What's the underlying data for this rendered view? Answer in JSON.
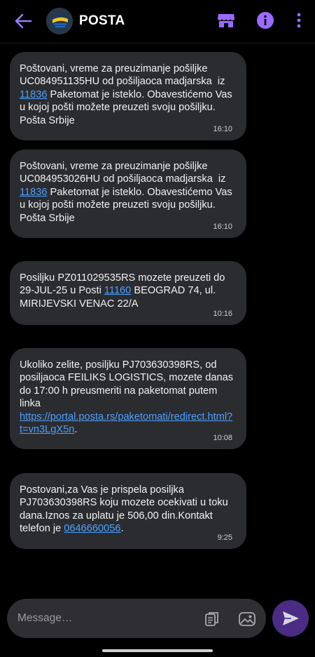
{
  "header": {
    "title": "POSTA",
    "back_icon": "arrow-back-icon",
    "avatar": "posta-logo",
    "actions": [
      "store-icon",
      "info-icon",
      "more-vert-icon"
    ],
    "accent_color": "#9b6bff"
  },
  "messages": [
    {
      "parts": [
        {
          "text": "Poštovani, vreme za preuzimanje pošiljke UC084951135HU od pošiljaoca madjarska  iz "
        },
        {
          "link": "11836"
        },
        {
          "text": " Paketomat je isteklо. Obavestićemo Vas u kojoj pošti možete preuzeti svoju pošiljku. Pošta Srbije"
        }
      ],
      "time": "16:10"
    },
    {
      "parts": [
        {
          "text": "Poštovani, vreme za preuzimanje pošiljke UC084953026HU od pošiljaoca madjarska  iz "
        },
        {
          "link": "11836"
        },
        {
          "text": " Paketomat je isteklo. Obavestićemo Vas u kojoj pošti možete preuzeti svoju pošiljku. Pošta Srbije"
        }
      ],
      "time": "16:10"
    },
    {
      "parts": [
        {
          "text": "Posiljku PZ011029535RS mozete preuzeti do 29-JUL-25 u Posti "
        },
        {
          "link": "11160"
        },
        {
          "text": " BEOGRAD 74, ul. MIRIJEVSKI VENAC 22/A"
        }
      ],
      "time": "10:16"
    },
    {
      "parts": [
        {
          "text": "Ukoliko zelite, posiljku PJ703630398RS, od posiljaoca FEILIKS LOGISTICS, mozete danas do 17:00 h preusmeriti na paketomat putem linka "
        },
        {
          "link": "https://portal.posta.rs/paketomati/redirect.html?t=vn3LgX5n"
        },
        {
          "text": "."
        }
      ],
      "time": "10:08"
    },
    {
      "parts": [
        {
          "text": "Postovani,za Vas je prispela posiljka PJ703630398RS koju mozete ocekivati u toku dana.Iznos za uplatu je 506,00 din.Kontakt telefon je "
        },
        {
          "link": "0646660056"
        },
        {
          "text": "."
        }
      ],
      "time": "9:25"
    }
  ],
  "composer": {
    "placeholder": "Message…",
    "icons": [
      "templates-icon",
      "gallery-icon",
      "send-icon"
    ],
    "send_color": "#4a2c84"
  }
}
